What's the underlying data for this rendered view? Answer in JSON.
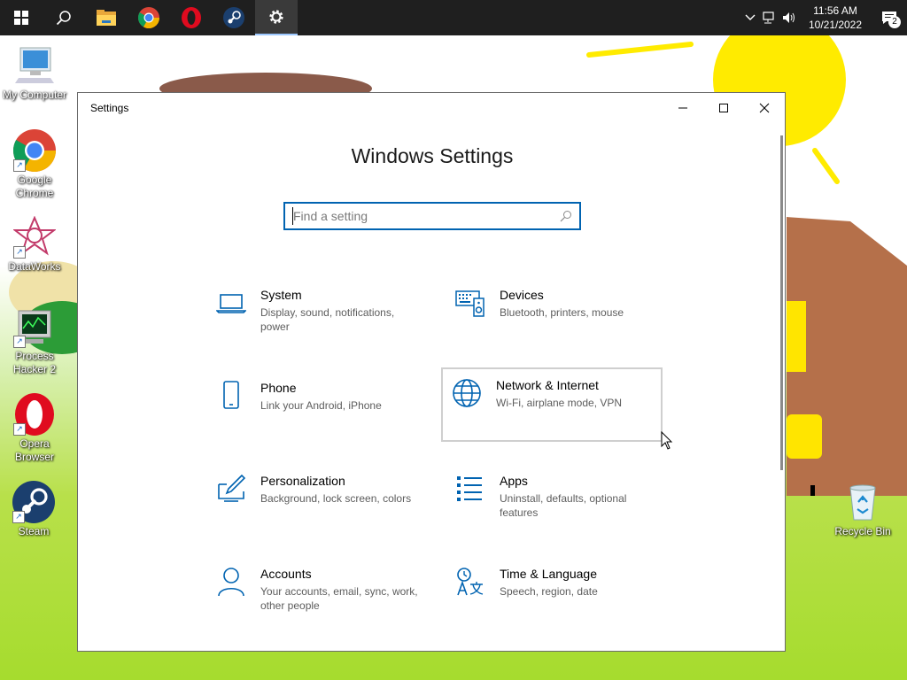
{
  "taskbar": {
    "apps": [
      {
        "name": "start",
        "icon": "windows-logo-icon"
      },
      {
        "name": "search",
        "icon": "search-icon"
      },
      {
        "name": "file-explorer",
        "icon": "folder-icon"
      },
      {
        "name": "chrome",
        "icon": "chrome-icon"
      },
      {
        "name": "opera",
        "icon": "opera-icon"
      },
      {
        "name": "steam",
        "icon": "steam-icon"
      },
      {
        "name": "settings",
        "icon": "gear-icon",
        "active": true
      }
    ],
    "tray": {
      "time": "11:56 AM",
      "date": "10/21/2022",
      "notification_count": "2"
    }
  },
  "desktop": {
    "icons": [
      {
        "label": "My Computer",
        "icon": "computer-icon"
      },
      {
        "label": "Google Chrome",
        "icon": "chrome-icon"
      },
      {
        "label": "DataWorks",
        "icon": "dataworks-icon"
      },
      {
        "label": "Process Hacker 2",
        "icon": "process-hacker-icon"
      },
      {
        "label": "Opera Browser",
        "icon": "opera-icon"
      },
      {
        "label": "Steam",
        "icon": "steam-icon"
      },
      {
        "label": "Recycle Bin",
        "icon": "recycle-bin-icon"
      }
    ]
  },
  "window": {
    "title": "Settings",
    "heading": "Windows Settings",
    "search": {
      "placeholder": "Find a setting",
      "value": ""
    },
    "accent": "#0063b1",
    "categories": [
      {
        "name": "System",
        "desc": "Display, sound, notifications, power",
        "icon": "laptop-icon"
      },
      {
        "name": "Devices",
        "desc": "Bluetooth, printers, mouse",
        "icon": "devices-icon"
      },
      {
        "name": "Phone",
        "desc": "Link your Android, iPhone",
        "icon": "phone-icon"
      },
      {
        "name": "Network & Internet",
        "desc": "Wi-Fi, airplane mode, VPN",
        "icon": "globe-icon",
        "hovered": true
      },
      {
        "name": "Personalization",
        "desc": "Background, lock screen, colors",
        "icon": "personalization-icon"
      },
      {
        "name": "Apps",
        "desc": "Uninstall, defaults, optional features",
        "icon": "apps-list-icon"
      },
      {
        "name": "Accounts",
        "desc": "Your accounts, email, sync, work, other people",
        "icon": "person-icon"
      },
      {
        "name": "Time & Language",
        "desc": "Speech, region, date",
        "icon": "time-language-icon"
      }
    ]
  }
}
